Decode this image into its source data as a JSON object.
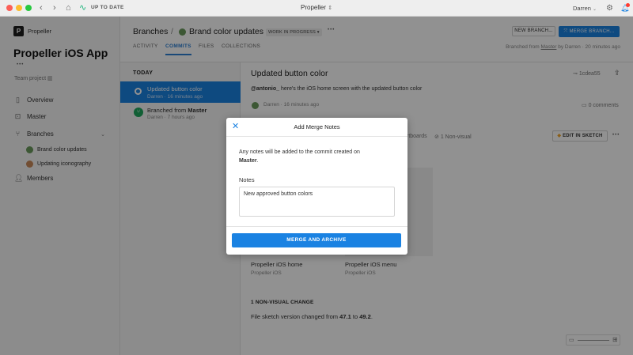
{
  "titlebar": {
    "status": "UP TO DATE",
    "app_title": "Propeller",
    "user": "Darren"
  },
  "sidebar": {
    "org": "Propeller",
    "project_title": "Propeller iOS App",
    "more": "•••",
    "team": "Team project",
    "nav": [
      {
        "label": "Overview"
      },
      {
        "label": "Master"
      },
      {
        "label": "Branches"
      },
      {
        "label": "Members"
      }
    ],
    "branches": [
      {
        "label": "Brand color updates"
      },
      {
        "label": "Updating iconography"
      }
    ]
  },
  "header": {
    "breadcrumb_root": "Branches",
    "separator": "/",
    "branch_name": "Brand color updates",
    "badge": "WORK IN PROGRESS ▾",
    "more": "•••",
    "tabs": [
      "ACTIVITY",
      "COMMITS",
      "FILES",
      "COLLECTIONS"
    ],
    "new_branch": "NEW BRANCH...",
    "merge_branch": "MERGE BRANCH...",
    "branched_from_prefix": "Branched from",
    "branched_from_link": "Master",
    "branched_from_suffix": "by Darren · 20 minutes ago"
  },
  "commits": {
    "section": "TODAY",
    "items": [
      {
        "title": "Updated button color",
        "meta": "Darren · 16 minutes ago"
      },
      {
        "title_prefix": "Branched from",
        "title_bold": "Master",
        "meta": "Darren · 7 hours ago"
      }
    ]
  },
  "detail": {
    "title": "Updated button color",
    "hash": "1cdea55",
    "mention": "@antonio_",
    "message": "here's the iOS home screen with the updated button color",
    "author_meta": "Darren · 16 minutes ago",
    "comments": "0 comments",
    "artboards": "rtboards",
    "nonvisual_count": "1 Non-visual",
    "edit_in_sketch": "EDIT IN SKETCH",
    "more": "•••",
    "cards": [
      {
        "name": "Propeller iOS home",
        "sub": "Propeller iOS"
      },
      {
        "name": "Propeller iOS menu",
        "sub": "Propeller iOS"
      }
    ],
    "nonvisual_header": "1 NON-VISUAL CHANGE",
    "change_prefix": "File sketch version changed from",
    "from_version": "47.1",
    "to": "to",
    "to_version": "49.2",
    "period": "."
  },
  "modal": {
    "title": "Add Merge Notes",
    "desc_line1": "Any notes will be added to the commit created on",
    "desc_bold": "Master",
    "desc_end": ".",
    "notes_label": "Notes",
    "notes_value": "New approved button colors",
    "action": "MERGE AND ARCHIVE"
  }
}
